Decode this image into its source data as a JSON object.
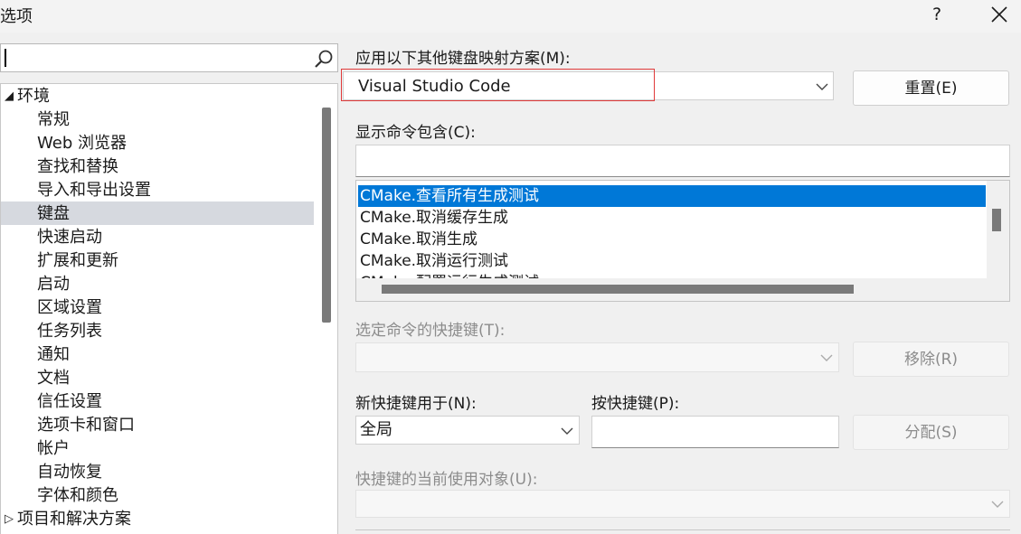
{
  "window": {
    "title": "选项",
    "help_label": "?"
  },
  "sidebar": {
    "search_placeholder": "",
    "items": [
      {
        "label": "环境",
        "expanded": true
      },
      {
        "label": "常规"
      },
      {
        "label": "Web 浏览器"
      },
      {
        "label": "查找和替换"
      },
      {
        "label": "导入和导出设置"
      },
      {
        "label": "键盘",
        "selected": true
      },
      {
        "label": "快速启动"
      },
      {
        "label": "扩展和更新"
      },
      {
        "label": "启动"
      },
      {
        "label": "区域设置"
      },
      {
        "label": "任务列表"
      },
      {
        "label": "通知"
      },
      {
        "label": "文档"
      },
      {
        "label": "信任设置"
      },
      {
        "label": "选项卡和窗口"
      },
      {
        "label": "帐户"
      },
      {
        "label": "自动恢复"
      },
      {
        "label": "字体和颜色"
      },
      {
        "label": "项目和解决方案",
        "expanded": false
      }
    ]
  },
  "keyboard": {
    "mapping_label": "应用以下其他键盘映射方案(M):",
    "mapping_value": "Visual Studio Code",
    "reset_button": "重置(E)",
    "show_commands_label": "显示命令包含(C):",
    "show_commands_value": "",
    "commands": [
      "CMake.查看所有生成测试",
      "CMake.取消缓存生成",
      "CMake.取消生成",
      "CMake.取消运行测试",
      "CMake.配置运行生成测试"
    ],
    "selected_shortcut_label": "选定命令的快捷键(T):",
    "selected_shortcut_value": "",
    "remove_button": "移除(R)",
    "use_new_shortcut_label": "新快捷键用于(N):",
    "use_new_shortcut_value": "全局",
    "press_shortcut_label": "按快捷键(P):",
    "press_shortcut_value": "",
    "assign_button": "分配(S)",
    "currently_used_by_label": "快捷键的当前使用对象(U):",
    "currently_used_by_value": ""
  },
  "colors": {
    "selection_blue": "#0078d7",
    "highlight_red": "#e03a3a",
    "tree_selected": "#d6d9df"
  }
}
